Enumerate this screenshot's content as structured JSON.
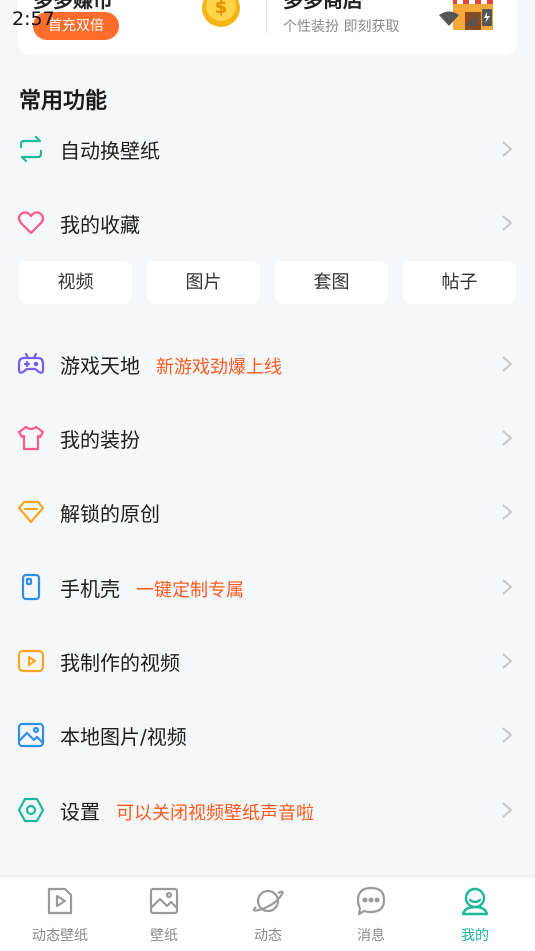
{
  "status_bar": {
    "time": "2:57"
  },
  "promo": {
    "left_title": "多多赚币",
    "badge": "首充双倍",
    "right_title": "多多商店",
    "right_subtitle": "个性装扮 即刻获取"
  },
  "section": {
    "title": "常用功能"
  },
  "rows": [
    {
      "label": "自动换壁纸",
      "tag": ""
    },
    {
      "label": "我的收藏",
      "tag": ""
    },
    {
      "label": "游戏天地",
      "tag": "新游戏劲爆上线"
    },
    {
      "label": "我的装扮",
      "tag": ""
    },
    {
      "label": "解锁的原创",
      "tag": ""
    },
    {
      "label": "手机壳",
      "tag": "一键定制专属"
    },
    {
      "label": "我制作的视频",
      "tag": ""
    },
    {
      "label": "本地图片/视频",
      "tag": ""
    },
    {
      "label": "设置",
      "tag": "可以关闭视频壁纸声音啦"
    }
  ],
  "chips": [
    "视频",
    "图片",
    "套图",
    "帖子"
  ],
  "bottom_nav": [
    {
      "label": "动态壁纸",
      "icon": "play-icon"
    },
    {
      "label": "壁纸",
      "icon": "image-icon"
    },
    {
      "label": "动态",
      "icon": "planet-icon"
    },
    {
      "label": "消息",
      "icon": "message-icon"
    },
    {
      "label": "我的",
      "icon": "profile-icon",
      "active": true
    }
  ],
  "colors": {
    "accent": "#1bb89a",
    "tag": "#ff5a1f",
    "badge": "#ff6d2d"
  }
}
